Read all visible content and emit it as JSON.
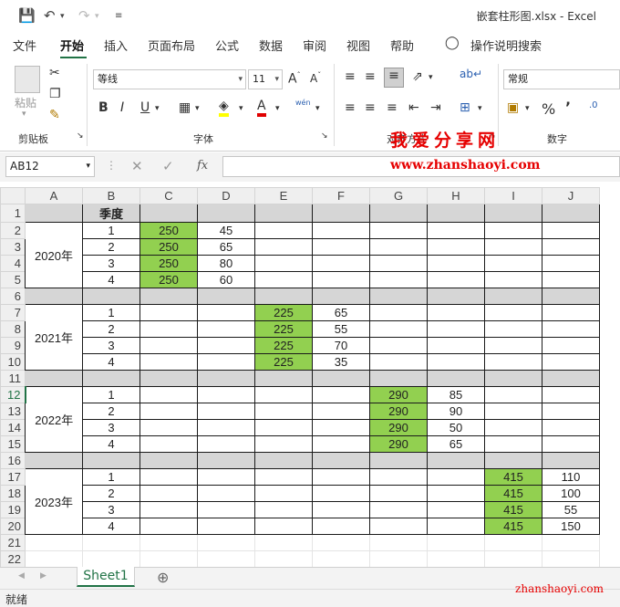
{
  "window": {
    "title": "嵌套柱形图.xlsx  -  Excel"
  },
  "tabs": [
    "文件",
    "开始",
    "插入",
    "页面布局",
    "公式",
    "数据",
    "审阅",
    "视图",
    "帮助"
  ],
  "tell_me": "操作说明搜索",
  "ribbon": {
    "paste_label": "粘贴",
    "clipboard_label": "剪贴板",
    "font_label": "字体",
    "font_name": "等线",
    "font_size": "11",
    "alignment_label": "对齐方式",
    "number_format": "常规",
    "number_label": "数字",
    "bold": "B",
    "italic": "I",
    "underline": "U",
    "wen": "wén"
  },
  "formula_bar": {
    "name_box": "AB12",
    "fx": "fx",
    "value": ""
  },
  "columns": [
    "A",
    "B",
    "C",
    "D",
    "E",
    "F",
    "G",
    "H",
    "I",
    "J"
  ],
  "row_numbers": [
    "1",
    "2",
    "3",
    "4",
    "5",
    "6",
    "7",
    "8",
    "9",
    "10",
    "11",
    "12",
    "13",
    "14",
    "15",
    "16",
    "17",
    "18",
    "19",
    "20",
    "21",
    "22"
  ],
  "header_cell": "季度",
  "years": [
    "2020年",
    "2021年",
    "2022年",
    "2023年"
  ],
  "blocks": [
    {
      "quarters": [
        "1",
        "2",
        "3",
        "4"
      ],
      "base": [
        "250",
        "250",
        "250",
        "250"
      ],
      "vals": [
        "45",
        "65",
        "80",
        "60"
      ]
    },
    {
      "quarters": [
        "1",
        "2",
        "3",
        "4"
      ],
      "base": [
        "225",
        "225",
        "225",
        "225"
      ],
      "vals": [
        "65",
        "55",
        "70",
        "35"
      ]
    },
    {
      "quarters": [
        "1",
        "2",
        "3",
        "4"
      ],
      "base": [
        "290",
        "290",
        "290",
        "290"
      ],
      "vals": [
        "85",
        "90",
        "50",
        "65"
      ]
    },
    {
      "quarters": [
        "1",
        "2",
        "3",
        "4"
      ],
      "base": [
        "415",
        "415",
        "415",
        "415"
      ],
      "vals": [
        "110",
        "100",
        "55",
        "150"
      ]
    }
  ],
  "sheet": {
    "name": "Sheet1"
  },
  "status": {
    "text": "就绪"
  },
  "watermark": {
    "cn": "我爱分享网",
    "url": "www.zhanshaoyi.com",
    "corner": "zhanshaoyi.com"
  },
  "colors": {
    "accent": "#217346",
    "highlight": "#92d050",
    "separator_row": "#d6d6d6",
    "watermark": "#e60000"
  }
}
